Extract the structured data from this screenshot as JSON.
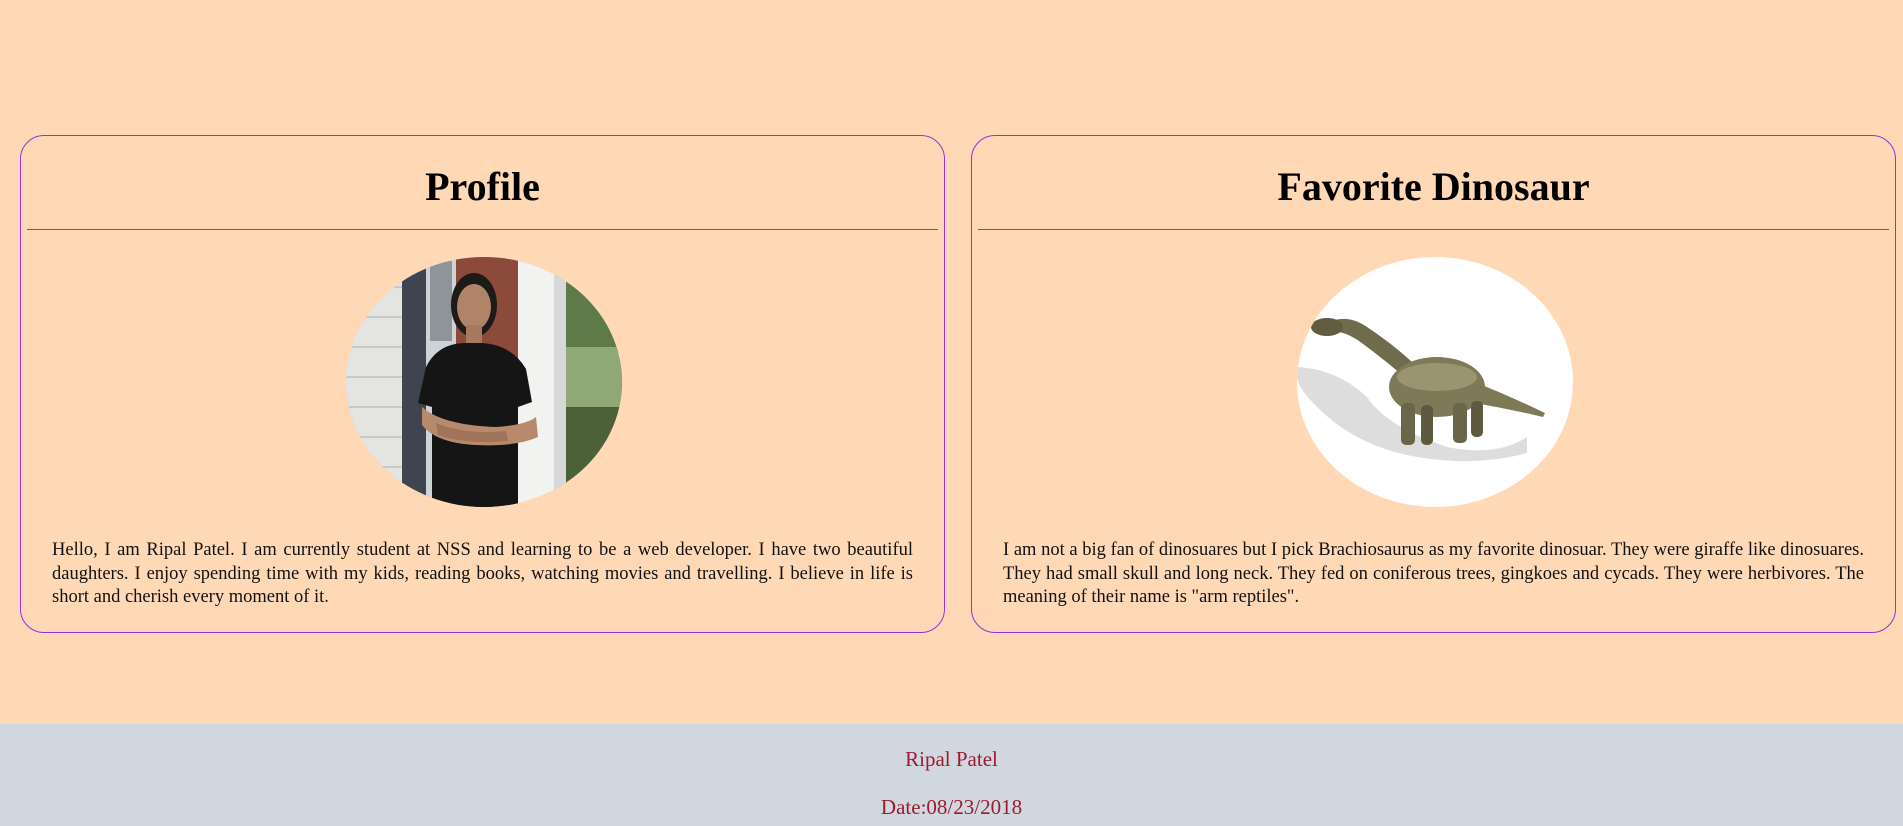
{
  "profile": {
    "title": "Profile",
    "description": "Hello, I am Ripal Patel. I am currently student at NSS and learning to be a web developer. I have two beautiful daughters. I enjoy spending time with my kids, reading books, watching movies and travelling. I believe in life is short and cherish every moment of it."
  },
  "dinosaur": {
    "title": "Favorite Dinosaur",
    "description": "I am not a big fan of dinosuares but I pick Brachiosaurus as my favorite dinosuar. They were giraffe like dinosuares. They had small skull and long neck. They fed on coniferous trees, gingkoes and cycads. They were herbivores. The meaning of their name is \"arm reptiles\"."
  },
  "footer": {
    "name": "Ripal Patel",
    "date": "Date:08/23/2018"
  },
  "colors": {
    "page_background": "#FFD9B6",
    "card_border": "#9B30D9",
    "footer_background": "#D0D7DF",
    "footer_text": "#9B1B30"
  }
}
